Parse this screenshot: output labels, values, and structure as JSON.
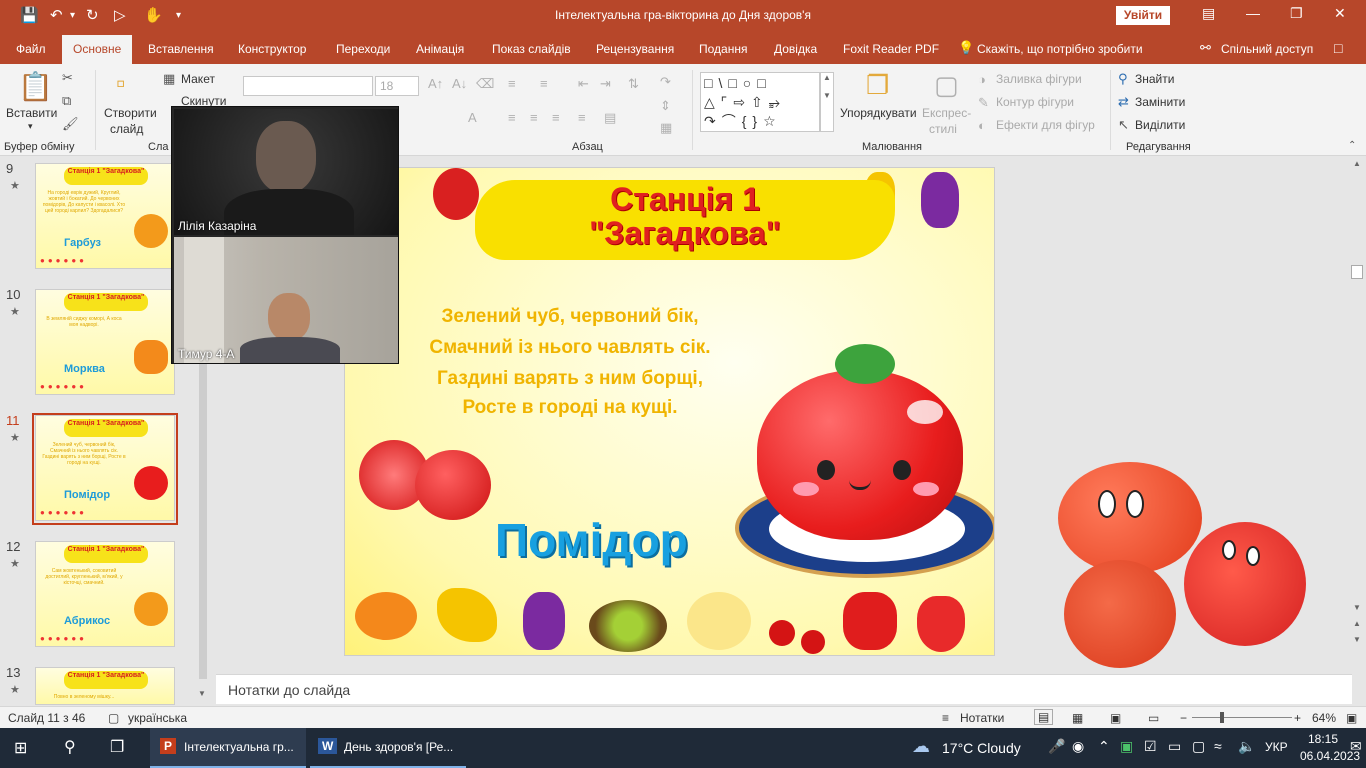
{
  "window": {
    "title": "Інтелектуальна гра-вікторина до Дня здоров'я",
    "signin": "Увійти",
    "qa_icons": [
      "save-icon",
      "undo-icon",
      "redo-icon",
      "slideshow-icon",
      "touch-icon",
      "customize-icon"
    ],
    "controls": [
      "ribbon-display-icon",
      "minimize-icon",
      "restore-icon",
      "close-icon"
    ]
  },
  "tabs": [
    "Файл",
    "Основне",
    "Вставлення",
    "Конструктор",
    "Переходи",
    "Анімація",
    "Показ слайдів",
    "Рецензування",
    "Подання",
    "Довідка",
    "Foxit Reader PDF",
    "Скажіть, що потрібно зробити",
    "Спільний доступ"
  ],
  "active_tab": "Основне",
  "ribbon": {
    "paste": "Вставити",
    "clipboard_group": "Буфер обміну",
    "new_slide_line1": "Створити",
    "new_slide_line2": "слайд",
    "layout": "Макет",
    "reset": "Скинути",
    "slides_group": "Сла",
    "font_size": "18",
    "paragraph_group": "Абзац",
    "arrange": "Упорядкувати",
    "quick_styles_line1": "Експрес-",
    "quick_styles_line2": "стилі",
    "shape_fill": "Заливка фігури",
    "shape_outline": "Контур фігури",
    "shape_effects": "Ефекти для фігур",
    "drawing_group": "Малювання",
    "find": "Знайти",
    "replace": "Замінити",
    "select": "Виділити",
    "editing_group": "Редагування"
  },
  "thumbnails": [
    {
      "num": "9",
      "title": "Станція 1 \"Загадкова\"",
      "text": "На городі еврік дужий, Круглий, жовтий і бокатий. До червоних помідорів, До капусти і квасолі. Хто цей городі кaрлил? Здогадалися?",
      "word": "Гарбуз",
      "color": "#f39a1b"
    },
    {
      "num": "10",
      "title": "Станція 1 \"Загадкова\"",
      "text": "В земляній сиджу коморі, А коса моя надворі.",
      "word": "Морква",
      "color": "#f38a1b"
    },
    {
      "num": "11",
      "title": "Станція 1 \"Загадкова\"",
      "text": "Зелений чуб, червоний бік, Смачний із нього чавлять сік. Газдині варять з ним борщі, Росте в городі на кущі.",
      "word": "Помідор",
      "color": "#e81d1d"
    },
    {
      "num": "12",
      "title": "Станція 1 \"Загадкова\"",
      "text": "Сам жовтенький, соковитий достиглий, кругленький, м'який, у кісточці, смачний.",
      "word": "Абрикос",
      "color": "#f39a1b"
    },
    {
      "num": "13",
      "title": "Станція 1 \"Загадкова\"",
      "text": "Повно в зеленому мішку...",
      "word": "",
      "color": "#8bc34a"
    }
  ],
  "video": [
    {
      "name": "Лілія Казаріна"
    },
    {
      "name": "Тимур 4-А"
    }
  ],
  "slide": {
    "station": "Станція 1",
    "station_name": "\"Загадкова\"",
    "riddle": [
      "Зелений чуб, червоний бік,",
      "Смачний із нього чавлять сік.",
      "Газдині варять з ним борщі,",
      "Росте в городі на кущі."
    ],
    "answer": "Помідор"
  },
  "notes": {
    "label": "Нотатки до слайда"
  },
  "status": {
    "slide_count": "Слайд 11 з 46",
    "language": "українська",
    "notes": "Нотатки",
    "zoom": "64%",
    "zoom_level": 0.64
  },
  "taskbar": {
    "apps": [
      "Інтелектуальна гр...",
      "День здоров'я [Ре..."
    ],
    "weather": "17°C  Cloudy",
    "lang": "УКР",
    "time": "18:15",
    "date": "06.04.2023"
  },
  "colors": {
    "accent": "#b7472a",
    "answer": "#18a0e0",
    "station": "#e02020",
    "riddle": "#f0b400"
  }
}
